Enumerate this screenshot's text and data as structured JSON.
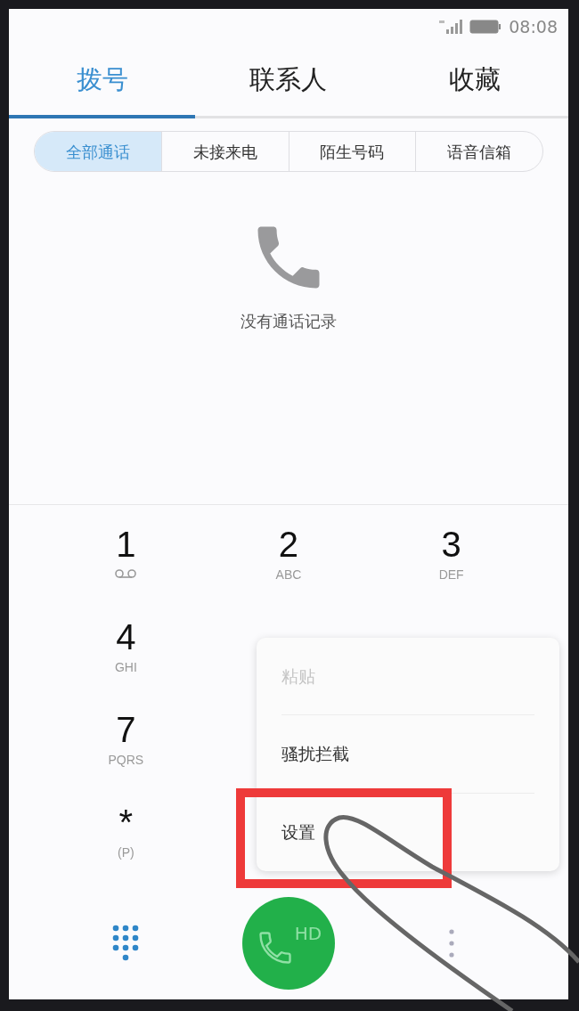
{
  "status_bar": {
    "time": "08:08"
  },
  "tabs": [
    {
      "label": "拨号",
      "selected": true
    },
    {
      "label": "联系人",
      "selected": false
    },
    {
      "label": "收藏",
      "selected": false
    }
  ],
  "filters": [
    {
      "label": "全部通话",
      "selected": true
    },
    {
      "label": "未接来电",
      "selected": false
    },
    {
      "label": "陌生号码",
      "selected": false
    },
    {
      "label": "语音信箱",
      "selected": false
    }
  ],
  "empty_state": {
    "message": "没有通话记录"
  },
  "keypad": [
    [
      {
        "digit": "1",
        "kind": "voicemail"
      },
      {
        "digit": "2",
        "letters": "ABC"
      },
      {
        "digit": "3",
        "letters": "DEF"
      }
    ],
    [
      {
        "digit": "4",
        "letters": "GHI"
      }
    ],
    [
      {
        "digit": "7",
        "letters": "PQRS"
      }
    ],
    [
      {
        "digit": "*",
        "letters": "(P)"
      }
    ]
  ],
  "menu": {
    "items": [
      {
        "label": "粘贴",
        "disabled": true,
        "highlighted": false
      },
      {
        "label": "骚扰拦截",
        "disabled": false,
        "highlighted": false
      },
      {
        "label": "设置",
        "disabled": false,
        "highlighted": true
      }
    ]
  },
  "call_button": {
    "label": "HD"
  }
}
